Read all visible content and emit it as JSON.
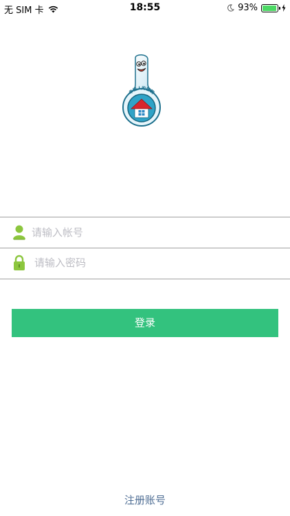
{
  "status_bar": {
    "carrier": "无 SIM 卡",
    "time": "18:55",
    "battery_percent": "93%",
    "battery_level": 0.93,
    "battery_color": "#4cd964"
  },
  "logo": {
    "icon": "spoon-mascot-logo",
    "text": "幸福人的饭碗"
  },
  "form": {
    "account": {
      "icon": "user-icon",
      "placeholder": "请输入帐号",
      "value": ""
    },
    "password": {
      "icon": "lock-icon",
      "placeholder": "请输入密码",
      "value": ""
    },
    "login_label": "登录",
    "login_color": "#33c27e"
  },
  "register_label": "注册账号",
  "colors": {
    "accent": "#33c27e",
    "link": "#4f6e94",
    "icon_green": "#8cc63e"
  }
}
